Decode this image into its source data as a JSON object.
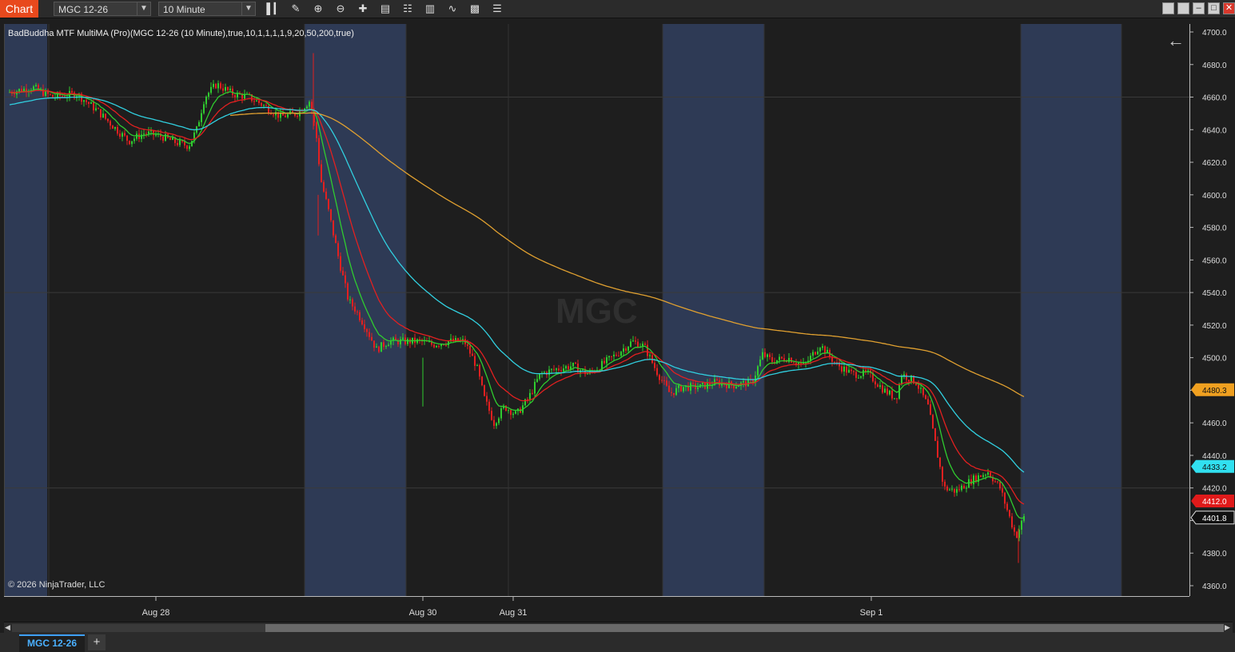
{
  "toolbar": {
    "chart_tab": "Chart",
    "instrument": "MGC 12-26",
    "interval": "10 Minute",
    "tools": [
      "bar-chart-icon",
      "pencil-icon",
      "zoom-in-icon",
      "zoom-out-icon",
      "crosshair-icon",
      "properties-icon",
      "strategies-icon",
      "indicators-icon",
      "data-series-icon",
      "template-icon",
      "menu-icon"
    ],
    "window_buttons": [
      "tile-icon",
      "restore-icon",
      "minimize-icon",
      "maximize-icon",
      "close-icon"
    ]
  },
  "chart": {
    "indicator_label": "BadBuddha MTF MultiMA (Pro)(MGC 12-26 (10 Minute),true,10,1,1,1,1,9,20,50,200,true)",
    "watermark": "MGC",
    "copyright": "© 2026 NinjaTrader, LLC",
    "price_ticks": [
      "4700.0",
      "4680.0",
      "4660.0",
      "4640.0",
      "4620.0",
      "4600.0",
      "4580.0",
      "4560.0",
      "4540.0",
      "4520.0",
      "4500.0",
      "4480.0",
      "4460.0",
      "4440.0",
      "4420.0",
      "4400.0",
      "4380.0",
      "4360.0"
    ],
    "time_ticks": [
      "Aug 28",
      "Aug 30",
      "Aug 31",
      "Sep 1"
    ],
    "price_tags": [
      {
        "label": "4480.3",
        "value": 4480.3,
        "color": "#f0a020",
        "text_color": "#111"
      },
      {
        "label": "4433.2",
        "value": 4433.2,
        "color": "#31e0f0",
        "text_color": "#111"
      },
      {
        "label": "4412.0",
        "value": 4412.0,
        "color": "#e01a1a",
        "text_color": "#fff"
      },
      {
        "label": "4401.8",
        "value": 4401.8,
        "color": "#111111",
        "text_color": "#fff"
      }
    ],
    "colors": {
      "up_candle": "#2fcc2f",
      "down_candle": "#e32020",
      "ma_fast": "#2fcc2f",
      "ma_slow": "#e32020",
      "ma_50": "#31d0e0",
      "ma_200": "#e0a030",
      "session_shade": "#2e3a55"
    }
  },
  "bottom": {
    "tab": "MGC 12-26",
    "add_tab": "+"
  }
}
